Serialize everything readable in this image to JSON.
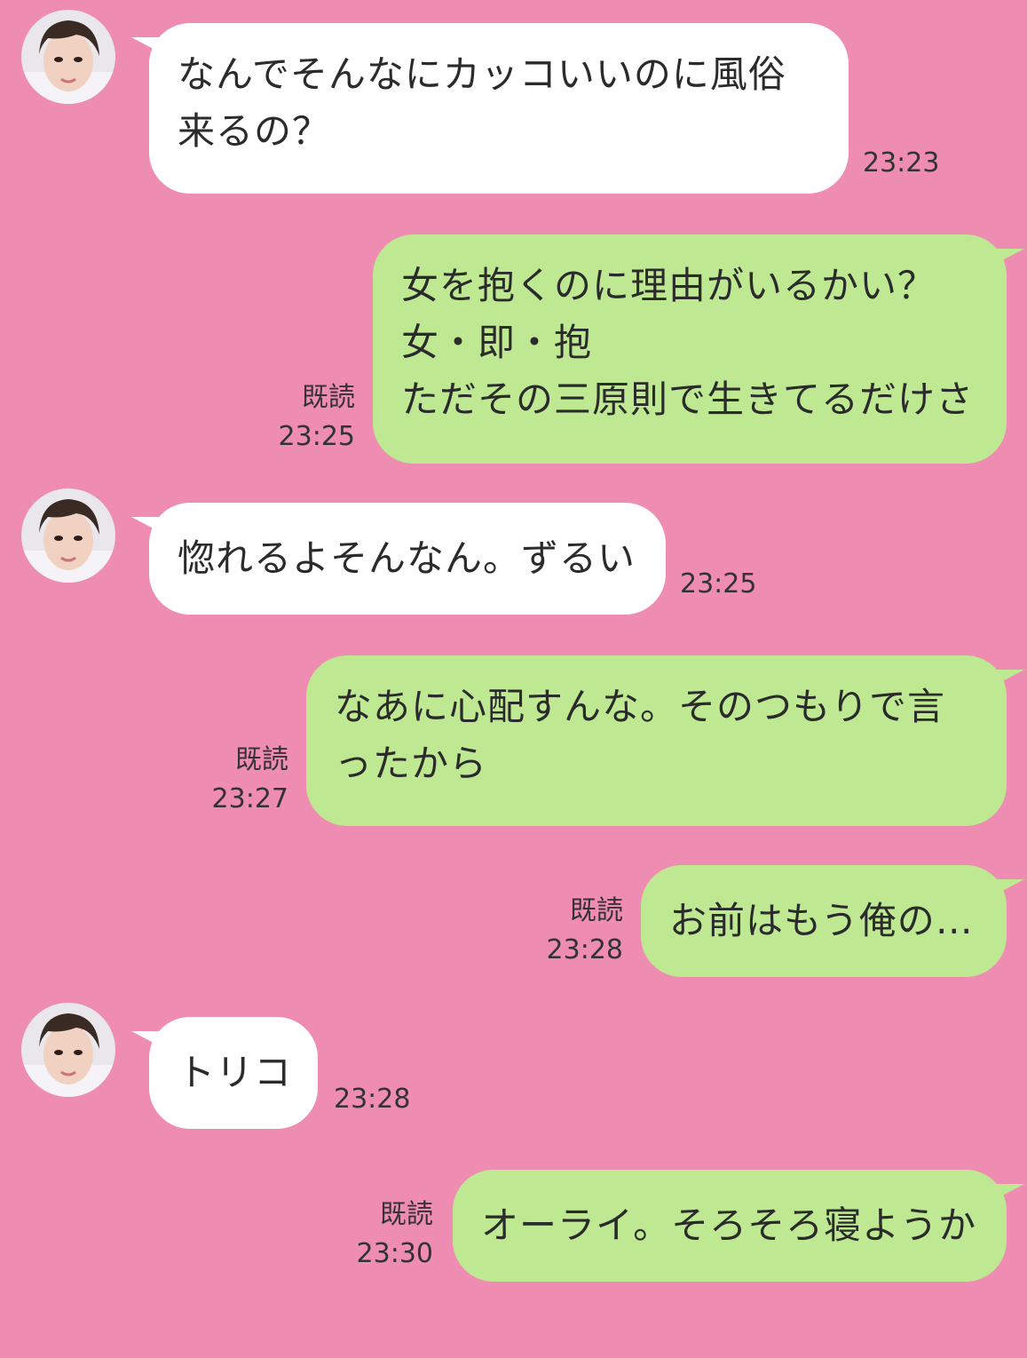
{
  "colors": {
    "background": "#ef8cb1",
    "incoming_bubble": "#ffffff",
    "outgoing_bubble": "#bfe893"
  },
  "messages": [
    {
      "side": "in",
      "lines": [
        "なんでそんなにカッコいいのに風俗",
        "来るの？"
      ],
      "time": "23:23"
    },
    {
      "side": "out",
      "lines": [
        "女を抱くのに理由がいるかい？",
        "女・即・抱",
        "ただその三原則で生きてるだけさ"
      ],
      "read": "既読",
      "time": "23:25"
    },
    {
      "side": "in",
      "lines": [
        "惚れるよそんなん。ずるい"
      ],
      "time": "23:25"
    },
    {
      "side": "out",
      "lines": [
        "なあに心配すんな。そのつもりで言",
        "ったから"
      ],
      "read": "既読",
      "time": "23:27"
    },
    {
      "side": "out",
      "lines": [
        "お前はもう俺の…"
      ],
      "read": "既読",
      "time": "23:28"
    },
    {
      "side": "in",
      "lines": [
        "トリコ"
      ],
      "time": "23:28"
    },
    {
      "side": "out",
      "lines": [
        "オーライ。そろそろ寝ようか"
      ],
      "read": "既読",
      "time": "23:30"
    }
  ]
}
